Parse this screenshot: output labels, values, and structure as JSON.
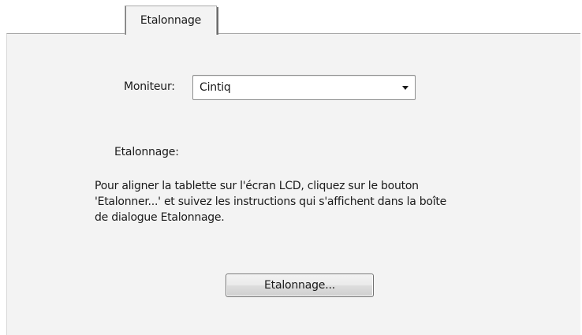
{
  "tab": {
    "label": "Etalonnage"
  },
  "monitor": {
    "label": "Moniteur:",
    "selected": "Cintiq"
  },
  "calibration": {
    "heading": "Etalonnage:",
    "description_lines": [
      "Pour aligner la tablette sur l'écran LCD, cliquez sur le bouton",
      "'Etalonner...' et suivez les instructions qui s'affichent dans la boîte",
      "de dialogue Etalonnage."
    ],
    "button_label": "Etalonnage..."
  },
  "colors": {
    "panel_background": "#f3f3f3",
    "border": "#a9a9a9"
  },
  "icons": {
    "dropdown": "chevron-down-icon"
  }
}
